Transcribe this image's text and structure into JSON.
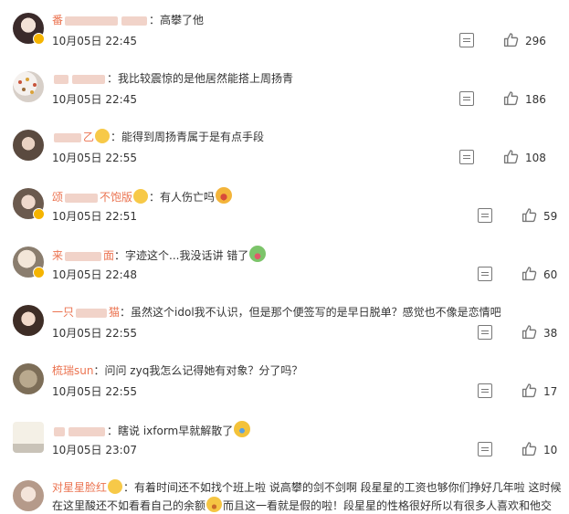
{
  "comments": [
    {
      "username": "",
      "text": "高攀了他",
      "date": "10月05日",
      "time": "22:45",
      "likes": "296"
    },
    {
      "username": "",
      "text": "我比较震惊的是他居然能搭上周扬青",
      "date": "10月05日",
      "time": "22:45",
      "likes": "186"
    },
    {
      "username": "乙",
      "text": "能得到周扬青属于是有点手段",
      "date": "10月05日",
      "time": "22:55",
      "likes": "108"
    },
    {
      "username_prefix": "颂",
      "username_suffix": "不饱版",
      "text": "有人伤亡吗",
      "date": "10月05日",
      "time": "22:51",
      "likes": "59"
    },
    {
      "username_prefix": "来",
      "username_suffix": "面",
      "text": "字迹这个...我没话讲 错了",
      "date": "10月05日",
      "time": "22:48",
      "likes": "60"
    },
    {
      "username_prefix": "一只",
      "username_suffix": "猫",
      "text": "虽然这个idol我不认识，但是那个便签写的是早日脱单？感觉也不像是恋情吧",
      "date": "10月05日",
      "time": "22:55",
      "likes": "38"
    },
    {
      "username": "梳瑞sun",
      "text": "问问 zyq我怎么记得她有对象？分了吗？",
      "date": "10月05日",
      "time": "22:55",
      "likes": "17"
    },
    {
      "username": "",
      "text": "瞎说 ixform早就解散了",
      "date": "10月05日",
      "time": "23:07",
      "likes": "10"
    },
    {
      "username": "对星星脸红",
      "text": "有着时间还不如找个班上啦 说高攀的剑不剑啊 段星星的工资也够你们挣好几年啦 这时候在这里酸还不如看看自己的余额",
      "text2": "而且这一看就是假的啦！段星星的性格很好所以有很多人喜欢和他交",
      "date": "",
      "time": "",
      "likes": ""
    }
  ],
  "colors": {
    "username": "#eb7350",
    "text": "#333333",
    "icon": "#777777",
    "badge": "#f5b400"
  },
  "icons": {
    "reply": "comment-reply-icon",
    "like": "thumbs-up-icon",
    "verified": "verified-badge-icon"
  }
}
